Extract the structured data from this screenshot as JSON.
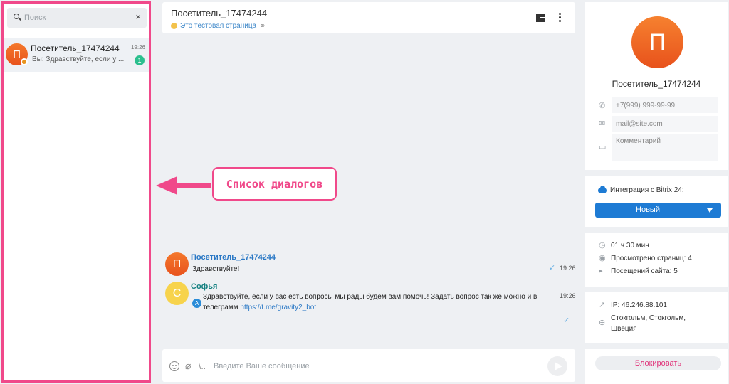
{
  "sidebar": {
    "search_placeholder": "Поиск",
    "clear_glyph": "×",
    "dialogs": [
      {
        "avatar_letter": "П",
        "name": "Посетитель_17474244",
        "preview": "Вы: Здравствуйте, если у ...",
        "time": "19:26",
        "unread": "1"
      }
    ]
  },
  "annotation": {
    "label": "Список диалогов",
    "color": "#f0498a"
  },
  "chat": {
    "title": "Посетитель_17474244",
    "subtitle": "Это тестовая страница",
    "messages": [
      {
        "avatar_letter": "П",
        "author": "Посетитель_17474244",
        "text": "Здравствуйте!",
        "time": "19:26"
      },
      {
        "avatar_letter": "С",
        "author": "Софья",
        "operator_letter": "A",
        "text_line1": "Здравствуйте, если у вас есть вопросы мы рады будем вам помочь! Задать вопрос так же можно и в",
        "text_line2_prefix": "телеграмм ",
        "link": "https://t.me/gravity2_bot",
        "time": "19:26"
      }
    ],
    "input_placeholder": "Введите Ваше сообщение",
    "slash_glyph": "\\.."
  },
  "visitor": {
    "avatar_letter": "П",
    "name": "Посетитель_17474244",
    "phone_placeholder": "+7(999) 999-99-99",
    "email_placeholder": "mail@site.com",
    "comment_placeholder": "Комментарий",
    "integration_label": "Интеграция с Bitrix 24:",
    "status_value": "Новый",
    "stats": {
      "duration": "01 ч 30 мин",
      "pages_viewed": "Просмотрено страниц: 4",
      "site_visits": "Посещений сайта: 5"
    },
    "ip": "IP: 46.246.88.101",
    "location": [
      "Стокгольм, Стокгольм,",
      "Швеция"
    ],
    "block_label": "Блокировать"
  },
  "colors": {
    "accent_blue": "#1e7bd4",
    "avatar_orange": "#e8521c",
    "avatar_yellow": "#f7d34c",
    "unread_green": "#2bbf8e",
    "annotation_pink": "#f0498a"
  }
}
